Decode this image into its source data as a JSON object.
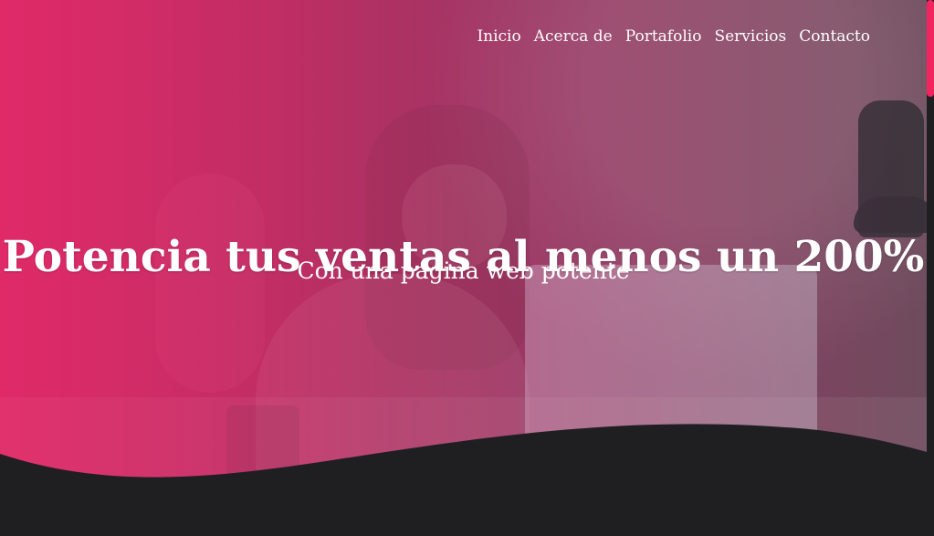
{
  "nav": {
    "items": [
      "Inicio",
      "Acerca de",
      "Portafolio",
      "Servicios",
      "Contacto"
    ]
  },
  "hero": {
    "headline": "Potencia tus ventas al menos un 200%",
    "subhead": "Con una página web potente"
  },
  "colors": {
    "accent": "#f2245f",
    "footer_bg": "#1f1f22"
  },
  "icons": {
    "scroll_thumb": "scrollbar-thumb"
  }
}
